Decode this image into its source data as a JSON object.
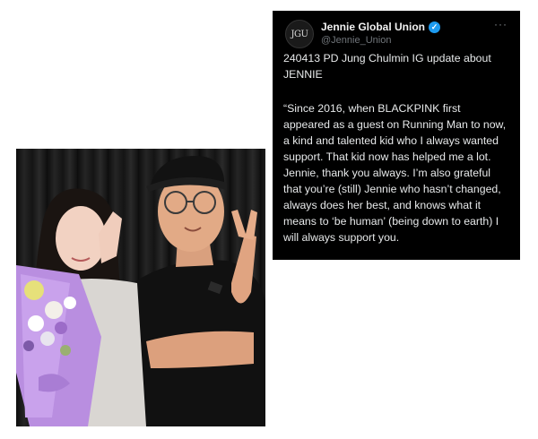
{
  "tweet": {
    "avatar_text": "JGU",
    "display_name": "Jennie Global Union",
    "verified_glyph": "✓",
    "handle": "@Jennie_Union",
    "more_glyph": "···",
    "title_lines": [
      "240413 PD Jung Chulmin IG update about",
      "JENNIE"
    ],
    "body_lines": [
      "“Since 2016, when BLACKPINK first",
      "appeared as a guest on Running Man to now,",
      "a kind and talented kid who I always wanted",
      "support. That kid now has helped me a lot.",
      "Jennie, thank you always. I’m also grateful",
      "that you’re (still) Jennie who hasn’t changed,",
      "always does her best, and knows what it",
      "means to ‘be human’ (being down to earth) I",
      "will always support you."
    ]
  },
  "colors": {
    "card_bg": "#000000",
    "verified": "#1d9bf0",
    "bouquet_wrap": "#b98ee0"
  }
}
